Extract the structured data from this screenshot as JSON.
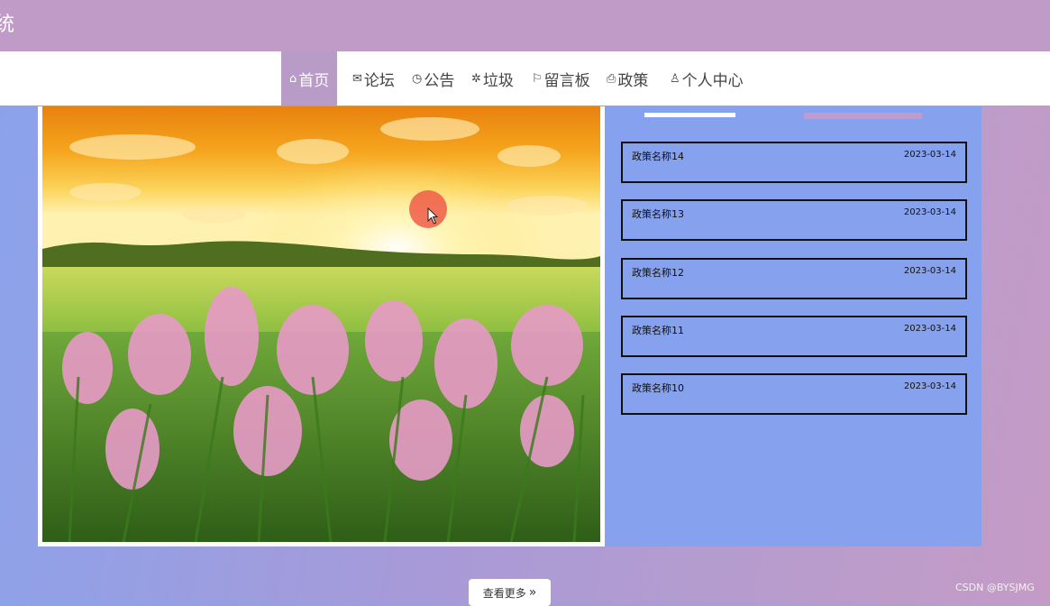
{
  "header": {
    "title_fragment": "统"
  },
  "nav": [
    {
      "icon": "home-icon",
      "glyph": "⌂",
      "label": "首页",
      "active": true
    },
    {
      "icon": "mail-icon",
      "glyph": "✉",
      "label": "论坛",
      "active": false
    },
    {
      "icon": "clock-icon",
      "glyph": "◷",
      "label": "公告",
      "active": false
    },
    {
      "icon": "gear-icon",
      "glyph": "✲",
      "label": "垃圾",
      "active": false
    },
    {
      "icon": "flag-icon",
      "glyph": "⚐",
      "label": "留言板",
      "active": false
    },
    {
      "icon": "printer-icon",
      "glyph": "⎙",
      "label": "政策",
      "active": false
    },
    {
      "icon": "user-icon",
      "glyph": "♙",
      "label": "个人中心",
      "active": false
    }
  ],
  "policies": [
    {
      "name": "政策名称14",
      "date": "2023-03-14"
    },
    {
      "name": "政策名称13",
      "date": "2023-03-14"
    },
    {
      "name": "政策名称12",
      "date": "2023-03-14"
    },
    {
      "name": "政策名称11",
      "date": "2023-03-14"
    },
    {
      "name": "政策名称10",
      "date": "2023-03-14"
    }
  ],
  "more_button": {
    "label": "查看更多",
    "icon": "double-chevron-right-icon",
    "glyph": "»"
  },
  "watermark": "CSDN @BYSJMG",
  "colors": {
    "topbar": "#c19bc8",
    "nav_active": "#b89bc6",
    "panel": "#86a1ee",
    "tab_accent": "#c09bcb"
  }
}
